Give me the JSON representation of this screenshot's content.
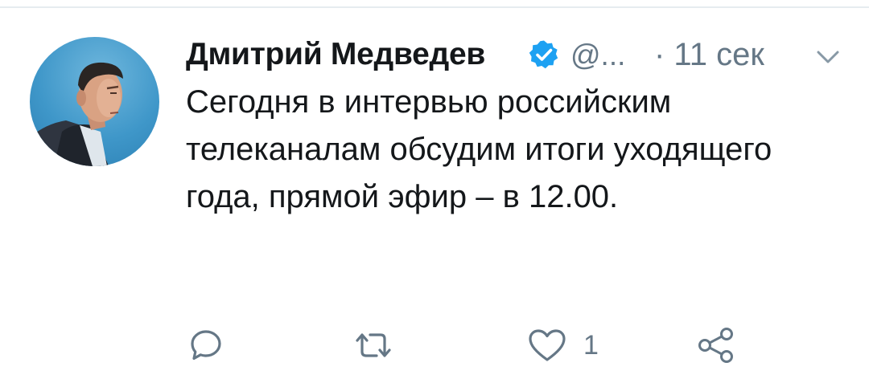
{
  "tweet": {
    "author_name": "Дмитрий Медведев",
    "handle": "@...",
    "time": "· 11 сек",
    "text": "Сегодня в интервью российским телеканалам обсудим итоги уходящего года, прямой эфир – в 12.00."
  },
  "actions": {
    "like_count": "1"
  },
  "colors": {
    "text": "#14171a",
    "secondary": "#657786",
    "verified": "#1da1f2"
  },
  "icons": {
    "verified": "verified-badge-icon",
    "menu": "chevron-down-icon",
    "reply": "reply-bubble-icon",
    "retweet": "retweet-icon",
    "like": "heart-icon",
    "share": "share-icon"
  }
}
